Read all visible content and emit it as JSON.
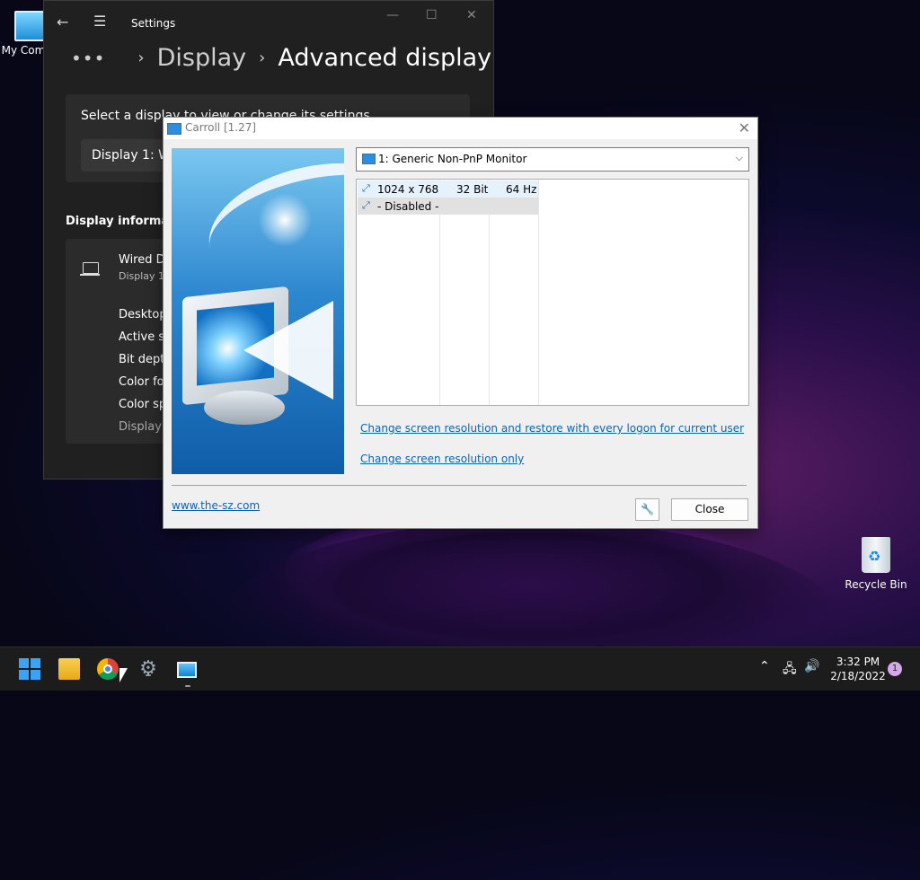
{
  "desktop": {
    "mycomputer_label": "My Com",
    "recyclebin_label": "Recycle Bin"
  },
  "settings": {
    "title": "Settings",
    "breadcrumb_parent": "Display",
    "breadcrumb_current": "Advanced display",
    "select_label": "Select a display to view or change its settings",
    "display_dropdown": "Display 1: Wi",
    "display_info_heading": "Display informati",
    "display_name": "Wired D",
    "display_sub": "Display 1:",
    "rows": [
      "Desktop",
      "Active si",
      "Bit dept",
      "Color fo",
      "Color sp",
      "Display"
    ]
  },
  "dialog": {
    "title": "Carroll [1.27]",
    "monitor_select": "1: Generic Non-PnP Monitor",
    "modes": [
      {
        "resolution": "1024 x 768",
        "depth": "32 Bit",
        "refresh": "64 Hz"
      },
      {
        "resolution": "- Disabled -",
        "depth": "",
        "refresh": ""
      }
    ],
    "link_restore": "Change screen resolution and restore with every logon for current user",
    "link_only": "Change screen resolution only",
    "website": "www.the-sz.com",
    "close_label": "Close"
  },
  "taskbar": {
    "time": "3:32 PM",
    "date": "2/18/2022",
    "notification_count": "1"
  },
  "colors": {
    "accent": "#0b63b6",
    "settings_bg": "#202020",
    "selection": "#e5f1fb"
  }
}
